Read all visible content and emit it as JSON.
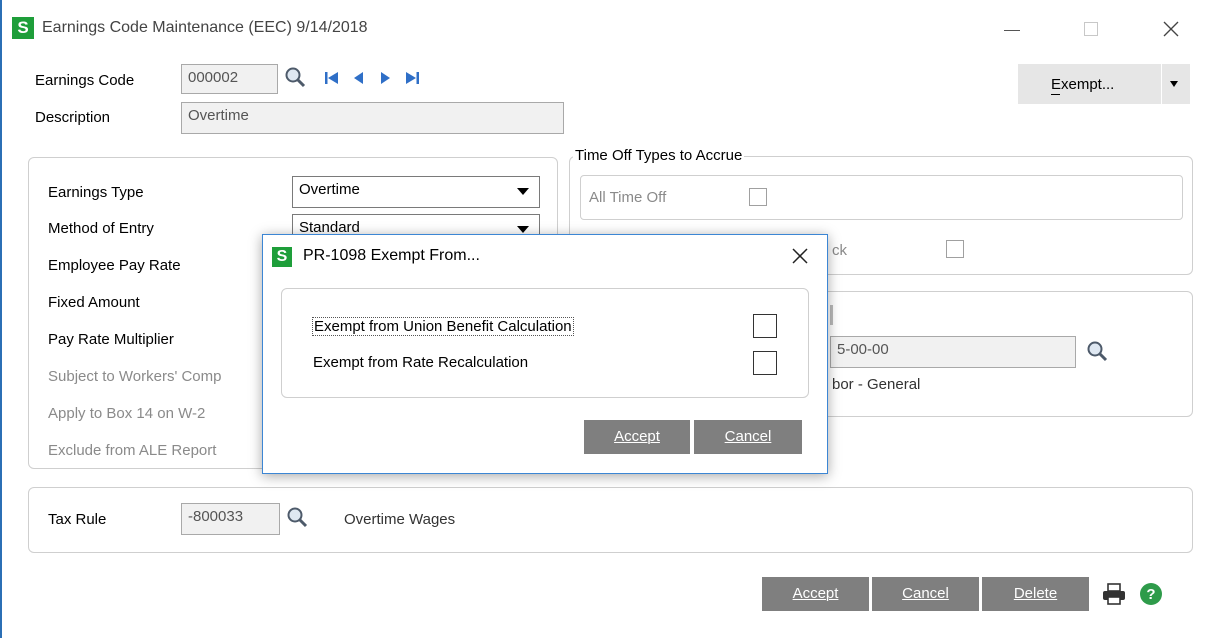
{
  "window": {
    "title": "Earnings Code Maintenance (EEC) 9/14/2018",
    "logo_letter": "S"
  },
  "header": {
    "earnings_code_label": "Earnings Code",
    "earnings_code_value": "000002",
    "description_label": "Description",
    "description_value": "Overtime",
    "exempt_button": "Exempt..."
  },
  "left_panel": {
    "earnings_type_label": "Earnings Type",
    "earnings_type_value": "Overtime",
    "method_of_entry_label": "Method of Entry",
    "method_of_entry_value": "Standard",
    "employee_pay_rate_label": "Employee Pay Rate",
    "fixed_amount_label": "Fixed Amount",
    "pay_rate_multiplier_label": "Pay Rate Multiplier",
    "workers_comp_label": "Subject to Workers' Comp",
    "box14_label": "Apply to Box 14 on W-2",
    "ale_label": "Exclude from ALE Report"
  },
  "time_off": {
    "group_label": "Time Off Types to Accrue",
    "all_time_off_label": "All Time Off",
    "partial_label": "ck"
  },
  "gl_panel": {
    "account_value": "5-00-00",
    "account_desc": "bor - General"
  },
  "tax": {
    "label": "Tax Rule",
    "value": "-800033",
    "desc": "Overtime Wages"
  },
  "footer": {
    "accept": "Accept",
    "cancel": "Cancel",
    "delete": "Delete"
  },
  "dialog": {
    "title": "PR-1098 Exempt From...",
    "logo_letter": "S",
    "union_label": "Exempt from Union Benefit Calculation",
    "rate_label": "Exempt from Rate Recalculation",
    "accept": "Accept",
    "cancel": "Cancel"
  }
}
